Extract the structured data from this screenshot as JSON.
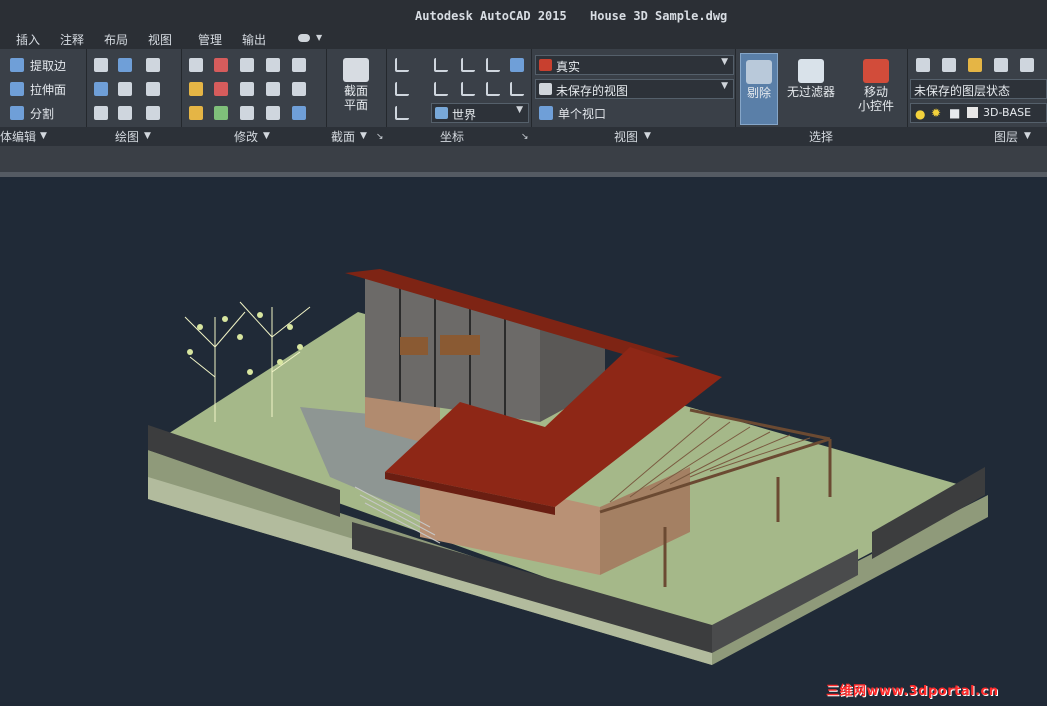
{
  "window": {
    "app_title": "Autodesk AutoCAD 2015",
    "document_title": "House 3D Sample.dwg"
  },
  "menu": {
    "items": [
      "插入",
      "注释",
      "布局",
      "视图",
      "管理",
      "输出"
    ]
  },
  "ribbon": {
    "solid_edit": {
      "extract_edges": "提取边",
      "extrude_faces": "拉伸面",
      "separate": "分割",
      "panel_label": "体编辑"
    },
    "draw": {
      "panel_label": "绘图"
    },
    "modify": {
      "panel_label": "修改"
    },
    "section": {
      "button_line1": "截面",
      "button_line2": "平面",
      "panel_label": "截面"
    },
    "coordinates": {
      "ucs_value": "世界",
      "panel_label": "坐标"
    },
    "view": {
      "visual_style": "真实",
      "named_view": "未保存的视图",
      "viewport_config": "单个视口",
      "panel_label": "视图"
    },
    "selection": {
      "culling": "剔除",
      "filter_line1": "无过滤器",
      "gizmo_line1": "移动",
      "gizmo_line2": "小控件",
      "panel_label": "选择"
    },
    "layers": {
      "layer_state": "未保存的图层状态",
      "current_layer": "3D-BASE",
      "panel_label": "图层"
    }
  },
  "colors": {
    "roof": "#8e2716",
    "wall": "#b99175",
    "lawn": "#a5b889",
    "fence": "#3c3d3e",
    "viewport_bg": "#202a37"
  },
  "watermark": "三维网www.3dportal.cn"
}
